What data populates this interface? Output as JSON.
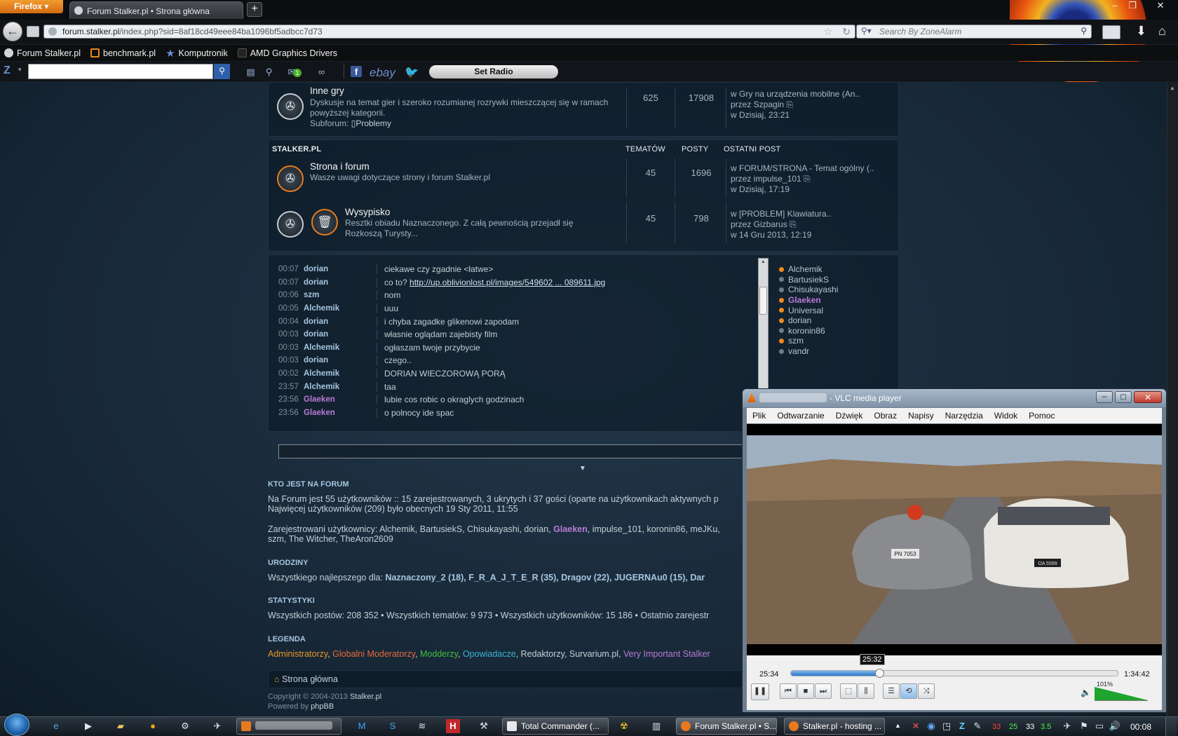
{
  "browser": {
    "app_button": "Firefox",
    "tab_title": "Forum Stalker.pl • Strona główna",
    "url_domain": "forum.stalker.pl",
    "url_path": "/index.php?sid=8af18cd49eee84ba1096bf5adbcc7d73",
    "search_placeholder": "Search By ZoneAlarm",
    "bookmarks": [
      "Forum Stalker.pl",
      "benchmark.pl",
      "Komputronik",
      "AMD Graphics Drivers"
    ],
    "radio_label": "Set Radio",
    "ebay_label": "ebay",
    "badge_count": "1"
  },
  "forum": {
    "inne": {
      "title": "Inne gry",
      "desc": "Dyskusje na temat gier i szeroko rozumianej rozrywki mieszczącej się w ramach powyższej kategorii.",
      "subforum_label": "Subforum:",
      "subforum": "Problemy",
      "topics": "625",
      "posts": "17908",
      "last1": "w Gry na urządzenia mobilne (An..",
      "last2": "przez Szpagin",
      "last3": "w Dzisiaj, 23:21"
    },
    "header": {
      "name": "STALKER.PL",
      "topics": "TEMATÓW",
      "posts": "POSTY",
      "last": "OSTATNI POST"
    },
    "strona": {
      "title": "Strona i forum",
      "desc": "Wasze uwagi dotyczące strony i forum Stalker.pl",
      "topics": "45",
      "posts": "1696",
      "last1": "w FORUM/STRONA - Temat ogólny (..",
      "last2": "przez impulse_101",
      "last3": "w Dzisiaj, 17:19"
    },
    "wysypisko": {
      "title": "Wysypisko",
      "desc1": "Resztki obiadu Naznaczonego. Z całą pewnością przejadł się",
      "desc2": "Rozkoszą Turysty...",
      "topics": "45",
      "posts": "798",
      "last1": "w [PROBLEM] Klawiatura..",
      "last2": "przez Gizbarus",
      "last3": "w 14 Gru 2013, 12:19"
    }
  },
  "chat": [
    {
      "time": "00:07",
      "user": "dorian",
      "msg": "ciekawe czy zgadnie <łatwe>"
    },
    {
      "time": "00:07",
      "user": "dorian",
      "msg_prefix": "co to? ",
      "link": "http://up.oblivionlost.pl/images/549602 ... 089611.jpg"
    },
    {
      "time": "00:06",
      "user": "szm",
      "msg": "nom"
    },
    {
      "time": "00:05",
      "user": "Alchemik",
      "msg": "uuu"
    },
    {
      "time": "00:04",
      "user": "dorian",
      "msg": "i chyba zagadke glikenowi zapodam"
    },
    {
      "time": "00:03",
      "user": "dorian",
      "msg": "własnie oglądam zajebisty film"
    },
    {
      "time": "00:03",
      "user": "Alchemik",
      "msg": "ogłaszam twoje przybycie"
    },
    {
      "time": "00:03",
      "user": "dorian",
      "msg": "czego.."
    },
    {
      "time": "00:02",
      "user": "Alchemik",
      "msg": "DORIAN WIECZOROWĄ PORĄ"
    },
    {
      "time": "23:57",
      "user": "Alchemik",
      "msg": "taa"
    },
    {
      "time": "23:56",
      "user": "Glaeken",
      "msg": "lubie cos robic o okraglych godzinach"
    },
    {
      "time": "23:56",
      "user": "Glaeken",
      "msg": "o polnocy ide spac"
    }
  ],
  "online": [
    "Alchemik",
    "BartusiekS",
    "Chisukayashi",
    "Glaeken",
    "Universal",
    "dorian",
    "koronin86",
    "szm",
    "vandr"
  ],
  "stats": {
    "who_title": "KTO JEST NA FORUM",
    "who_line1": "Na Forum jest 55 użytkowników :: 15 zarejestrowanych, 3 ukrytych i 37 gości (oparte na użytkownikach aktywnych p",
    "who_line2": "Najwięcej użytkowników (209) było obecnych 19 Sty 2011, 11:55",
    "reg_prefix": "Zarejestrowani użytkownicy: Alchemik, BartusiekS, Chisukayashi, dorian, ",
    "reg_glaeken": "Glaeken",
    "reg_suffix": ", impulse_101, koronin86, meJKu,",
    "reg_line2": "szm, The Witcher, TheAron2609",
    "bday_title": "URODZINY",
    "bday_prefix": "Wszystkiego najlepszego dla: ",
    "bday_names": "Naznaczony_2 (18), F_R_A_J_T_E_R (35), Dragov (22), JUGERNAu0 (15), Dar",
    "stat_title": "STATYSTYKI",
    "stat_line": "Wszystkich postów: 208 352 • Wszystkich tematów: 9 973 • Wszystkich użytkowników: 15 186 • Ostatnio zarejestr",
    "legend_title": "LEGENDA",
    "legend": [
      {
        "label": "Administratorzy",
        "color": "#e8962a"
      },
      {
        "label": "Globalni Moderatorzy",
        "color": "#e86a3a"
      },
      {
        "label": "Modderzy",
        "color": "#3fbf3f"
      },
      {
        "label": "Opowiadacze",
        "color": "#3ab4d8"
      },
      {
        "label": "Redaktorzy",
        "color": "#c6d0d8"
      },
      {
        "label": "Survarium.pl",
        "color": "#c6d0d8"
      },
      {
        "label": "Very Important Stalker",
        "color": "#b97ad6"
      }
    ],
    "home": "Strona główna",
    "copyright_prefix": "Copyright © 2004-2013 ",
    "copyright_site": "Stalker.pl",
    "powered_prefix": "Powered by ",
    "powered": "phpBB"
  },
  "vlc": {
    "title": "- VLC media player",
    "menu": [
      "Plik",
      "Odtwarzanie",
      "Dźwięk",
      "Obraz",
      "Napisy",
      "Narzędzia",
      "Widok",
      "Pomoc"
    ],
    "time_current": "25:34",
    "time_tooltip": "25:32",
    "time_total": "1:34:42",
    "progress": 0.27,
    "volume": "101%",
    "plate_left": "PN 7053",
    "plate_right": "OA 5599"
  },
  "taskbar": {
    "items": [
      "Total Commander (...",
      "Forum Stalker.pl • S...",
      "Stalker.pl - hosting ..."
    ],
    "clock": "00:08",
    "tray_nums": [
      "33",
      "25",
      "33",
      "3.5"
    ]
  }
}
